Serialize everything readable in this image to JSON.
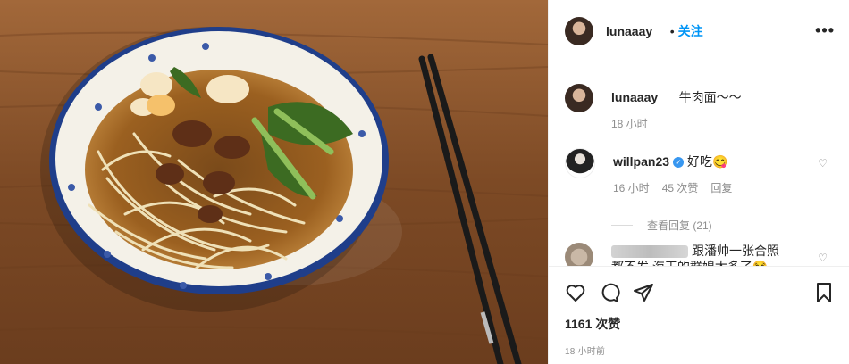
{
  "post": {
    "author": "lunaaay__",
    "follow_label": "关注",
    "separator": "•",
    "more_icon": "•••",
    "caption": "牛肉面～～",
    "caption_time": "18 小时",
    "likes": "1161 次赞",
    "posted_time": "18 小时前"
  },
  "comments": [
    {
      "user": "willpan23",
      "text": "好吃😋",
      "time": "16 小时",
      "likes": "45 次赞",
      "reply_label": "回复",
      "view_replies": "查看回复 (21)"
    },
    {
      "user": "",
      "text": "跟潘帅一张合照",
      "text2": "都不发 海王的群媳太多了😂"
    }
  ],
  "colors": {
    "accent": "#0095f6",
    "muted": "#8e8e8e",
    "border": "#efefef"
  }
}
